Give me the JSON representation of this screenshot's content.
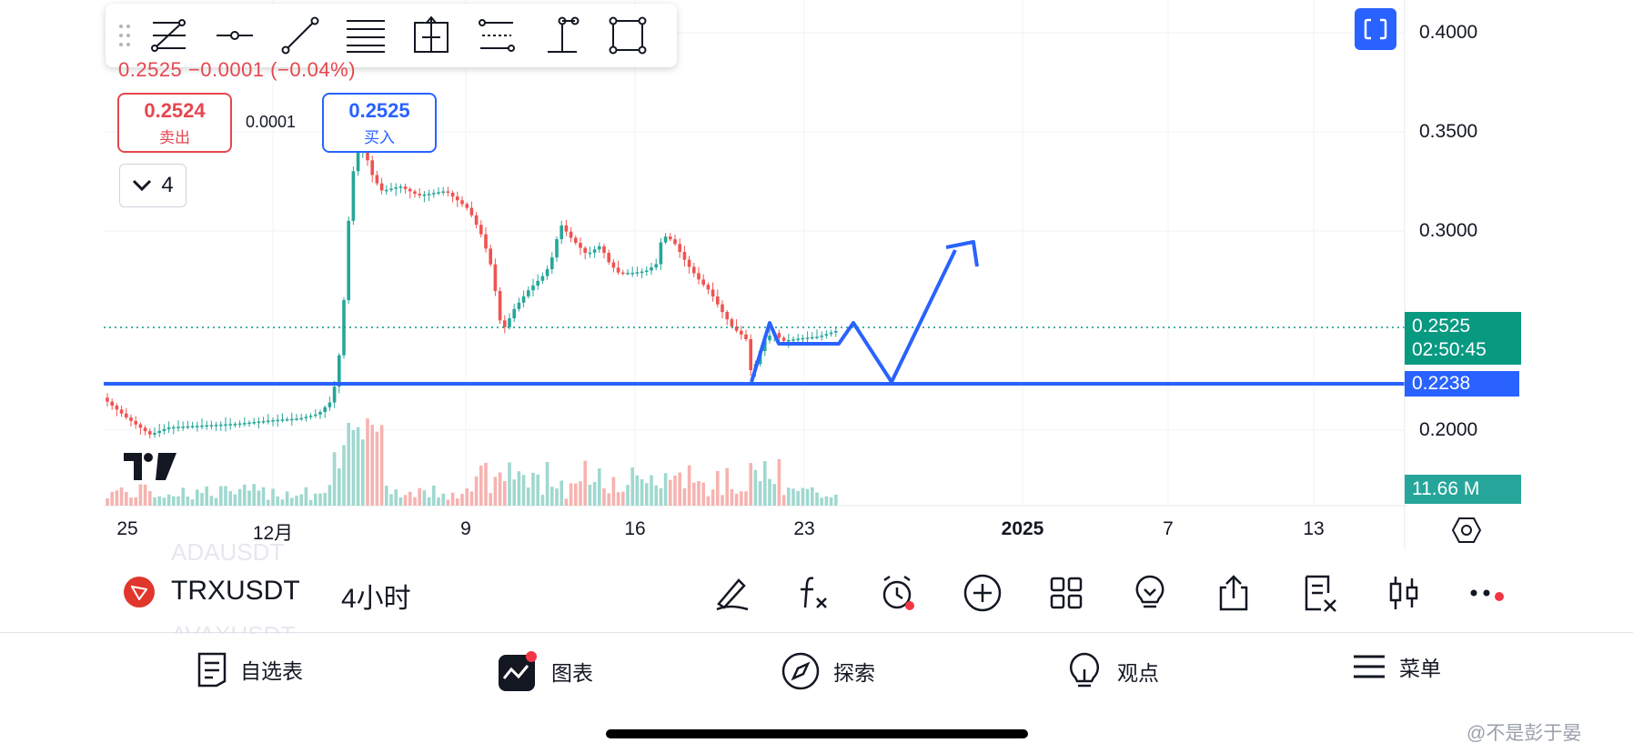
{
  "toolbar": {
    "tools": [
      {
        "icon": "fib-retracement-icon"
      },
      {
        "icon": "horizontal-ray-icon"
      },
      {
        "icon": "trend-line-icon"
      },
      {
        "icon": "parallel-channel-icon"
      },
      {
        "icon": "price-range-icon"
      },
      {
        "icon": "fib-channel-icon"
      },
      {
        "icon": "vertical-range-icon"
      },
      {
        "icon": "rectangle-icon"
      }
    ]
  },
  "header": {
    "price_change": "0.2525 −0.0001 (−0.04%)",
    "sell": {
      "value": "0.2524",
      "label": "卖出"
    },
    "buy": {
      "value": "0.2525",
      "label": "买入"
    },
    "spread": "0.0001",
    "indicator_count": "4"
  },
  "price_axis": {
    "ticks": [
      "0.4000",
      "0.3500",
      "0.3000",
      "0.2000"
    ],
    "current_price": "0.2525",
    "countdown": "02:50:45",
    "support_price": "0.2238",
    "volume": "11.66 M"
  },
  "time_axis": {
    "ticks": [
      "25",
      "12月",
      "9",
      "16",
      "23",
      "2025",
      "7",
      "13"
    ]
  },
  "symbol_bar": {
    "symbol": "TRXUSDT",
    "timeframe": "4小时",
    "ghost_above": "ADAUSDT",
    "ghost_below": "AVAXUSDT",
    "actions": [
      "draw-pen-icon",
      "indicator-fx-icon",
      "alert-clock-icon",
      "add-icon",
      "layout-grid-icon",
      "ideas-bulb-icon",
      "share-icon",
      "order-book-icon",
      "candle-type-icon",
      "more-icon"
    ]
  },
  "nav": {
    "items": [
      {
        "label": "自选表",
        "icon": "watchlist-icon"
      },
      {
        "label": "图表",
        "icon": "chart-icon"
      },
      {
        "label": "探索",
        "icon": "compass-icon"
      },
      {
        "label": "观点",
        "icon": "ideas-icon"
      },
      {
        "label": "菜单",
        "icon": "menu-icon"
      }
    ]
  },
  "watermark": "@不是彭于晏",
  "colors": {
    "up": "#26a69a",
    "down": "#ef5350",
    "accent": "#2962ff",
    "current": "#089981"
  }
}
